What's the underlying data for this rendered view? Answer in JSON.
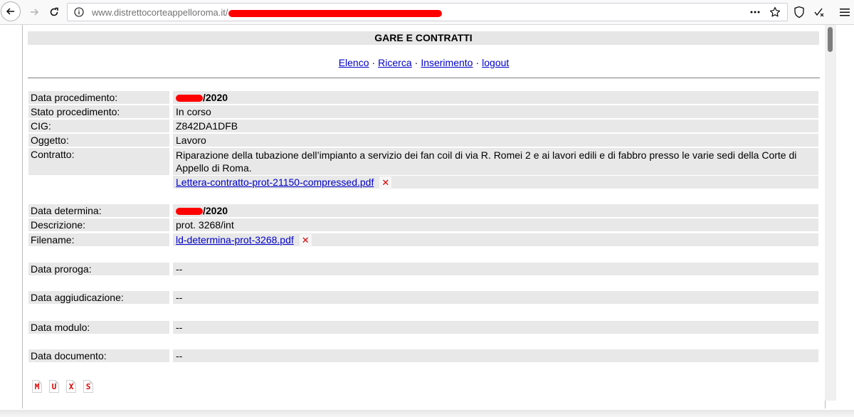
{
  "browser": {
    "url_domain": "www.distrettocorteappelloroma.it/",
    "url_redacted": true
  },
  "page": {
    "title": "GARE E CONTRATTI",
    "nav": [
      "Elenco",
      "Ricerca",
      "Inserimento",
      "logout"
    ],
    "separator": "·"
  },
  "procedimento": {
    "data_label": "Data procedimento:",
    "data_suffix": "/2020",
    "stato_label": "Stato procedimento:",
    "stato_value": "In corso",
    "cig_label": "CIG:",
    "cig_value": "Z842DA1DFB",
    "oggetto_label": "Oggetto:",
    "oggetto_value": "Lavoro",
    "contratto_label": "Contratto:",
    "contratto_value": "Riparazione della tubazione dell’impianto a servizio dei fan coil di via R. Romei 2 e ai lavori edili e di fabbro presso le varie sedi della Corte di Appello di Roma.",
    "contratto_file": "Lettera-contratto-prot-21150-compressed.pdf"
  },
  "determina": {
    "data_label": "Data determina:",
    "data_suffix": "/2020",
    "descrizione_label": "Descrizione:",
    "descrizione_value": "prot. 3268/int",
    "filename_label": "Filename:",
    "filename_value": "ld-determina-prot-3268.pdf"
  },
  "altre_date": [
    {
      "label": "Data proroga:",
      "value": "--"
    },
    {
      "label": "Data aggiudicazione:",
      "value": "--"
    },
    {
      "label": "Data modulo:",
      "value": "--"
    },
    {
      "label": "Data documento:",
      "value": "--"
    }
  ],
  "delete_glyph": "✕",
  "action_icons": [
    "M",
    "U",
    "X",
    "S"
  ],
  "colors": {
    "link": "#0000cc",
    "row_bg": "#e8e8e8",
    "title_bg": "#e6e6e6",
    "redaction": "#ff0000",
    "delete": "#e00000"
  }
}
